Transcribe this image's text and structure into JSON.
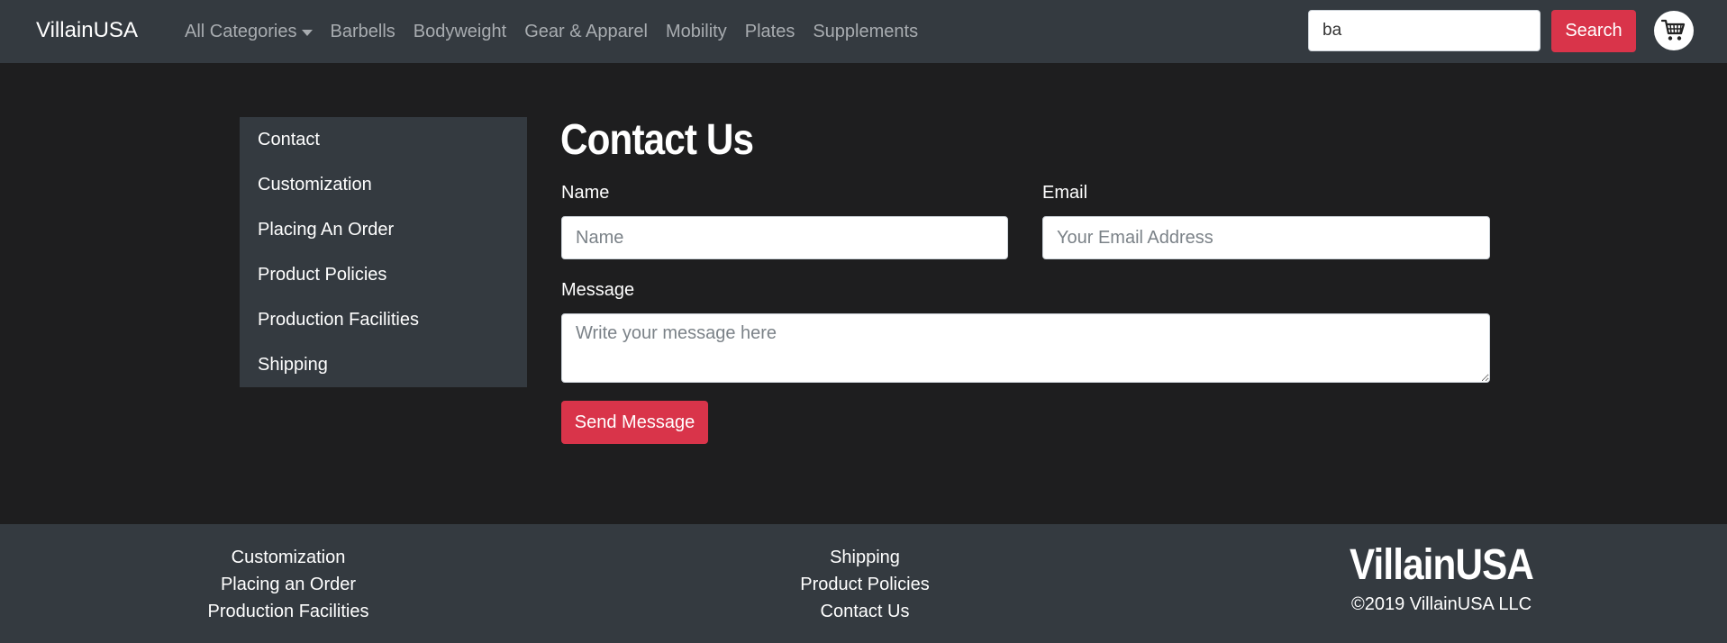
{
  "navbar": {
    "brand": "VillainUSA",
    "links": [
      "All Categories",
      "Barbells",
      "Bodyweight",
      "Gear & Apparel",
      "Mobility",
      "Plates",
      "Supplements"
    ],
    "search_value": "ba",
    "search_button": "Search"
  },
  "sidebar": {
    "items": [
      "Contact",
      "Customization",
      "Placing An Order",
      "Product Policies",
      "Production Facilities",
      "Shipping"
    ]
  },
  "form": {
    "title": "Contact Us",
    "name_label": "Name",
    "name_placeholder": "Name",
    "email_label": "Email",
    "email_placeholder": "Your Email Address",
    "message_label": "Message",
    "message_placeholder": "Write your message here",
    "submit": "Send Message"
  },
  "footer": {
    "col1": [
      "Customization",
      "Placing an Order",
      "Production Facilities"
    ],
    "col2": [
      "Shipping",
      "Product Policies",
      "Contact Us"
    ],
    "brand": "VillainUSA",
    "copyright": "©2019 VillainUSA LLC"
  },
  "colors": {
    "accent": "#d9344a",
    "navbar_bg": "#343a40",
    "page_bg": "#1e1e1f"
  }
}
